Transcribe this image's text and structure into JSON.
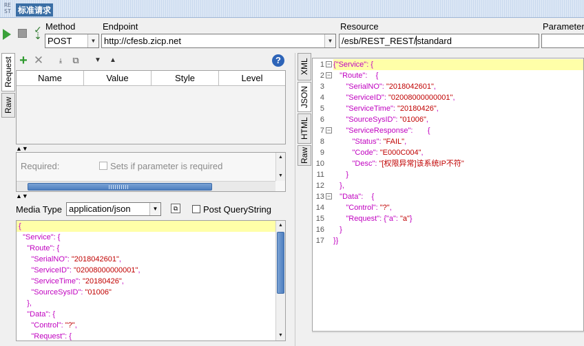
{
  "window": {
    "logo_line1": "RE",
    "logo_line2": "ST",
    "title": "标准请求"
  },
  "toolbar": {
    "run": "▶",
    "stop": "■"
  },
  "method": {
    "label": "Method",
    "value": "POST"
  },
  "endpoint": {
    "label": "Endpoint",
    "value": "http://cfesb.zicp.net"
  },
  "resource": {
    "label": "Resource",
    "value_before": "/esb/REST_REST/",
    "value_after": "standard"
  },
  "parameters": {
    "label": "Parameter"
  },
  "left_tabs": [
    "Request",
    "Raw"
  ],
  "param_table": {
    "columns": [
      "Name",
      "Value",
      "Style",
      "Level"
    ]
  },
  "required": {
    "label": "Required:",
    "checkbox_label": "Sets if parameter is required"
  },
  "media": {
    "label": "Media Type",
    "value": "application/json",
    "post_querystring": "Post QueryString"
  },
  "request_body": [
    "{",
    "  \"Service\": {",
    "    \"Route\": {",
    "      \"SerialNO\": \"2018042601\",",
    "      \"ServiceID\": \"02008000000001\",",
    "      \"ServiceTime\": \"20180426\",",
    "      \"SourceSysID\": \"01006\"",
    "    },",
    "    \"Data\": {",
    "      \"Control\": \"?\",",
    "      \"Request\": {"
  ],
  "right_tabs": [
    "XML",
    "JSON",
    "HTML",
    "Raw"
  ],
  "response_lines": [
    {
      "n": "1",
      "fold": "−",
      "text": "{\"Service\": {"
    },
    {
      "n": "2",
      "fold": "−",
      "text": "   \"Route\":    {"
    },
    {
      "n": "3",
      "fold": "",
      "text": "      \"SerialNO\": \"2018042601\","
    },
    {
      "n": "4",
      "fold": "",
      "text": "      \"ServiceID\": \"02008000000001\","
    },
    {
      "n": "5",
      "fold": "",
      "text": "      \"ServiceTime\": \"20180426\","
    },
    {
      "n": "6",
      "fold": "",
      "text": "      \"SourceSysID\": \"01006\","
    },
    {
      "n": "7",
      "fold": "−",
      "text": "      \"ServiceResponse\":       {"
    },
    {
      "n": "8",
      "fold": "",
      "text": "         \"Status\": \"FAIL\","
    },
    {
      "n": "9",
      "fold": "",
      "text": "         \"Code\": \"E000C004\","
    },
    {
      "n": "10",
      "fold": "",
      "text": "         \"Desc\": \"[权限异常]该系统IP不符\""
    },
    {
      "n": "11",
      "fold": "",
      "text": "      }"
    },
    {
      "n": "12",
      "fold": "",
      "text": "   },"
    },
    {
      "n": "13",
      "fold": "−",
      "text": "   \"Data\":    {"
    },
    {
      "n": "14",
      "fold": "",
      "text": "      \"Control\": \"?\","
    },
    {
      "n": "15",
      "fold": "",
      "text": "      \"Request\": {\"a\": \"a\"}"
    },
    {
      "n": "16",
      "fold": "",
      "text": "   }"
    },
    {
      "n": "17",
      "fold": "",
      "text": "}}"
    }
  ],
  "colors": {
    "key": "#c000c0",
    "string": "#c00000",
    "highlight": "#ffffa8",
    "accent": "#3a6ea5"
  }
}
